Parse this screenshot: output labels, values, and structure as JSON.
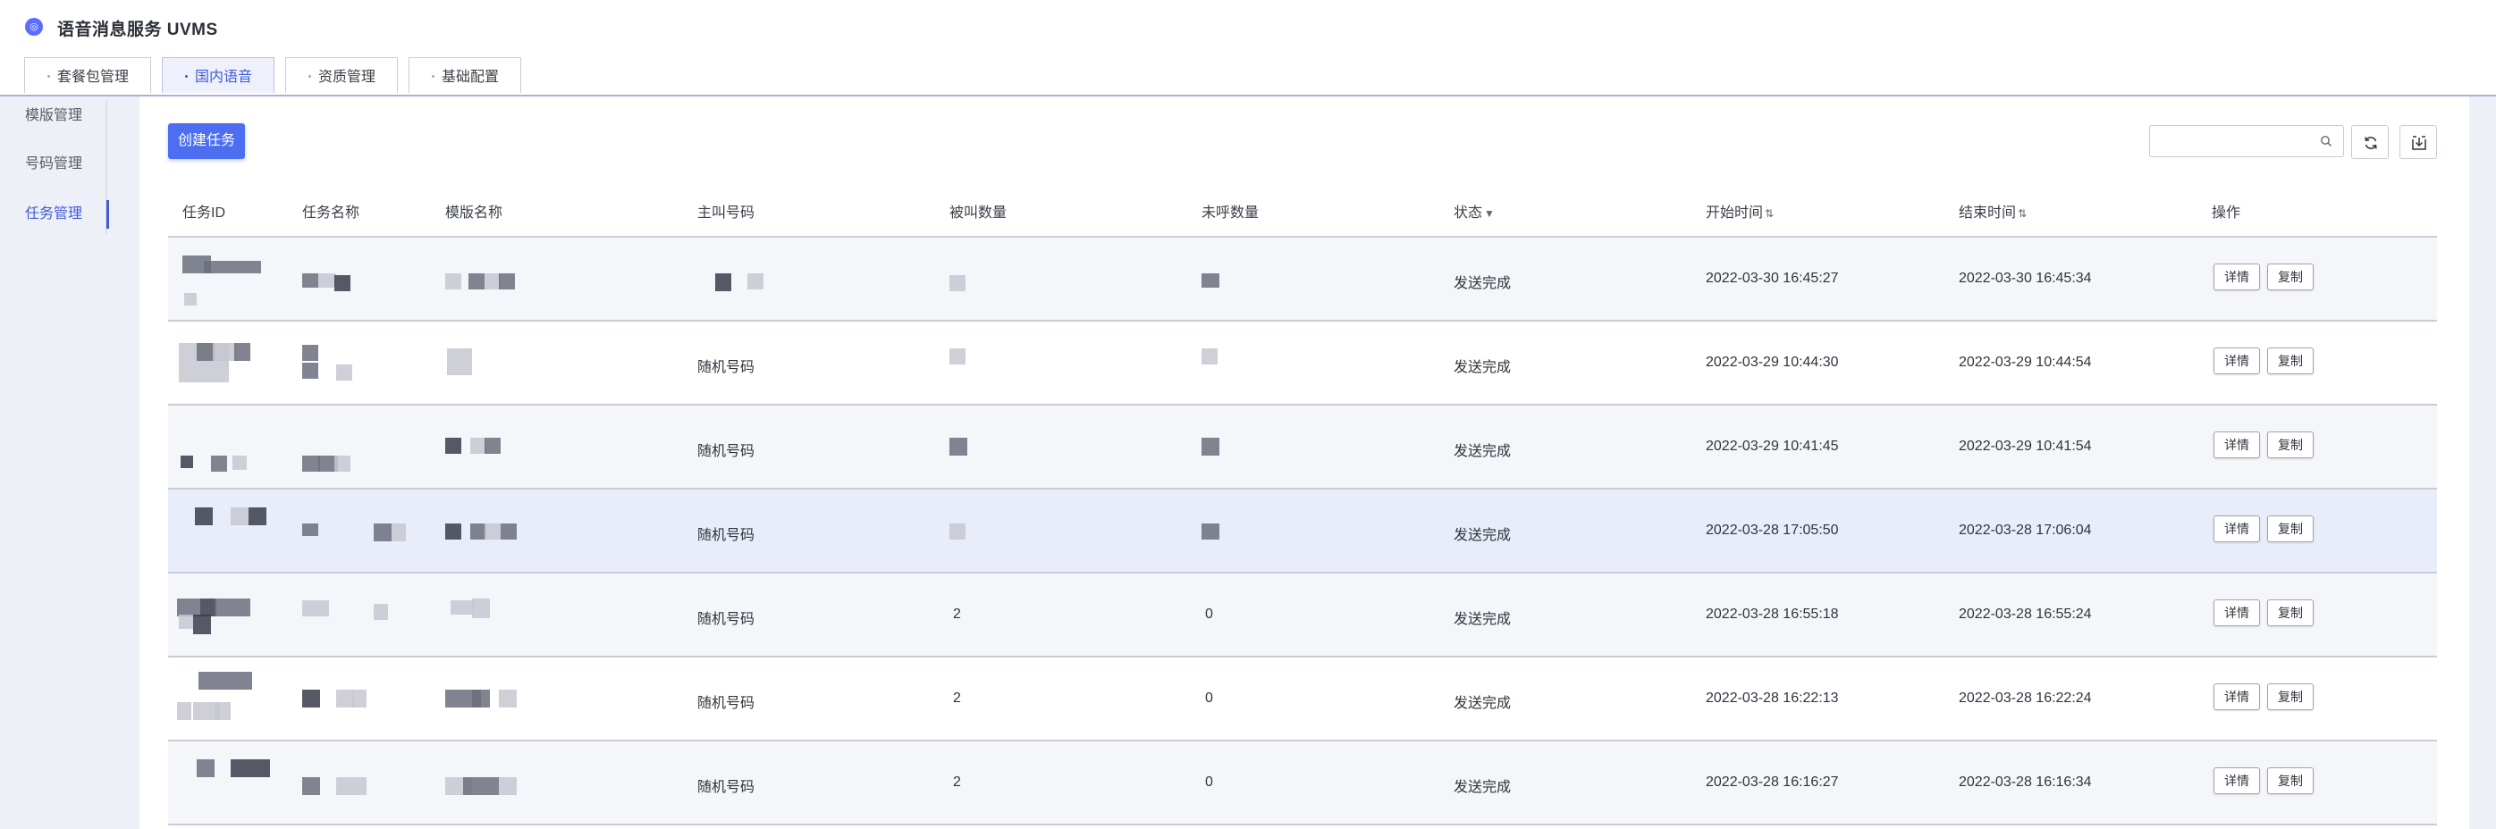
{
  "app": {
    "title": "语音消息服务 UVMS",
    "logo_text": "◎"
  },
  "tabs": [
    {
      "label": "套餐包管理",
      "active": false
    },
    {
      "label": "国内语音",
      "active": true
    },
    {
      "label": "资质管理",
      "active": false
    },
    {
      "label": "基础配置",
      "active": false
    }
  ],
  "sidebar": {
    "items": [
      {
        "label": "模版管理",
        "active": false
      },
      {
        "label": "号码管理",
        "active": false
      },
      {
        "label": "任务管理",
        "active": true
      }
    ]
  },
  "toolbar": {
    "create_label": "创建任务",
    "search_placeholder": "",
    "icons": [
      "search-icon",
      "refresh-icon",
      "download-icon"
    ]
  },
  "table": {
    "columns": [
      "任务ID",
      "任务名称",
      "模版名称",
      "主叫号码",
      "被叫数量",
      "未呼数量",
      "状态",
      "开始时间",
      "结束时间",
      "操作"
    ],
    "sort_icon": "⇅",
    "filter_icon": "▼",
    "rows": [
      {
        "caller": "",
        "called": "",
        "uncalled": "",
        "status": "发送完成",
        "start": "2022-03-30 16:45:27",
        "end": "2022-03-30 16:45:34"
      },
      {
        "caller": "随机号码",
        "called": "",
        "uncalled": "",
        "status": "发送完成",
        "start": "2022-03-29 10:44:30",
        "end": "2022-03-29 10:44:54"
      },
      {
        "caller": "随机号码",
        "called": "",
        "uncalled": "",
        "status": "发送完成",
        "start": "2022-03-29 10:41:45",
        "end": "2022-03-29 10:41:54"
      },
      {
        "caller": "随机号码",
        "called": "",
        "uncalled": "",
        "status": "发送完成",
        "start": "2022-03-28 17:05:50",
        "end": "2022-03-28 17:06:04"
      },
      {
        "caller": "随机号码",
        "called": "2",
        "uncalled": "0",
        "status": "发送完成",
        "start": "2022-03-28 16:55:18",
        "end": "2022-03-28 16:55:24"
      },
      {
        "caller": "随机号码",
        "called": "2",
        "uncalled": "0",
        "status": "发送完成",
        "start": "2022-03-28 16:22:13",
        "end": "2022-03-28 16:22:24"
      },
      {
        "caller": "随机号码",
        "called": "2",
        "uncalled": "0",
        "status": "发送完成",
        "start": "2022-03-28 16:16:27",
        "end": "2022-03-28 16:16:34"
      }
    ],
    "actions": {
      "detail": "详情",
      "copy": "复制"
    }
  },
  "colors": {
    "accent": "#4d6ef0",
    "active_tab": "#3f5bd9",
    "highlight_row": "#e9edfa",
    "stripe_row": "#f5f6fa",
    "redaction_dark": "#3a3d4a",
    "redaction_mid": "#6b6e7c",
    "redaction_light": "#c5c7d0"
  }
}
